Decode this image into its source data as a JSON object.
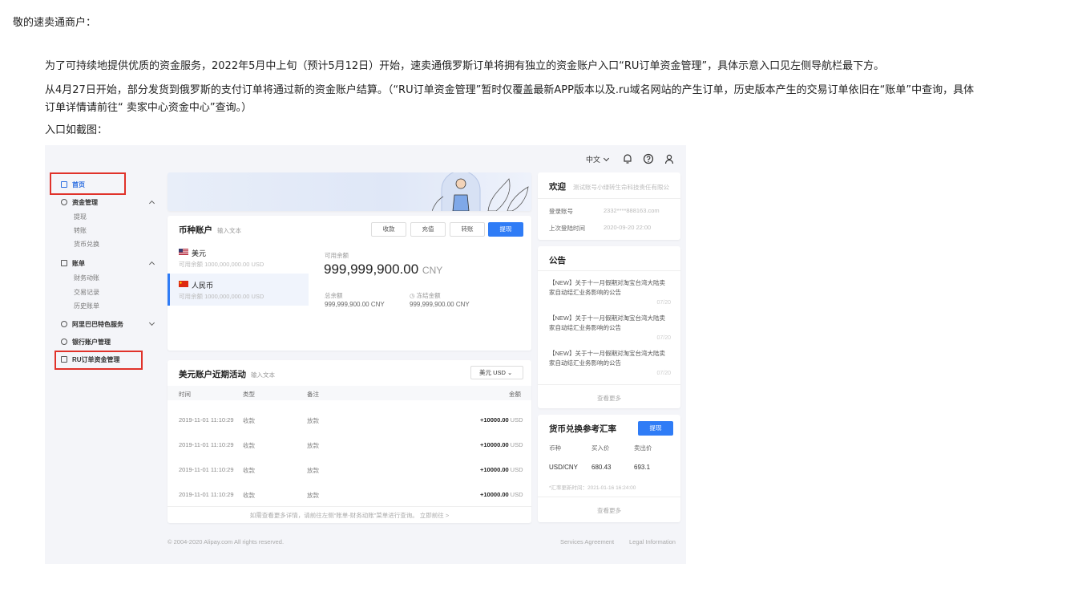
{
  "letter": {
    "greeting": "敬的速卖通商户：",
    "paragraph1": "为了可持续地提供优质的资金服务，2022年5月中上旬（预计5月12日）开始，速卖通俄罗斯订单将拥有独立的资金账户入口“RU订单资金管理”，具体示意入口见左侧导航栏最下方。",
    "paragraph2_line1": "从4月27日开始，部分发货到俄罗斯的支付订单将通过新的资金账户结算。（“RU订单资金管理”暂时仅覆盖最新APP版本以及.ru域名网站的产生订单，历史版本产生的交易订单依旧在“账单”中查询，具体",
    "paragraph2_line2": "订单详情请前往“ 卖家中心资金中心”查询。）",
    "entry_caption": "入口如截图："
  },
  "topbar": {
    "language": "中文"
  },
  "sidebar": {
    "home": "首页",
    "funds": "资金管理",
    "funds_items": [
      "提现",
      "转账",
      "货币兑换"
    ],
    "bill": "账单",
    "bill_items": [
      "财务动账",
      "交易记录",
      "历史账单"
    ],
    "alibaba": "阿里巴巴特色服务",
    "bank": "银行账户管理",
    "ru": "RU订单资金管理"
  },
  "account_card": {
    "title": "币种账户",
    "search_placeholder": "输入文本",
    "buttons": [
      "收款",
      "充值",
      "转账",
      "提现"
    ],
    "currencies": [
      {
        "name": "美元",
        "limit": "可用余额 1000,000,000.00 USD"
      },
      {
        "name": "人民币",
        "limit": "可用余额 1000,000,000.00 USD"
      }
    ],
    "available_label": "可用余额",
    "available_value": "999,999,900.00",
    "available_unit": "CNY",
    "total_label": "总余额",
    "total_value": "999,999,900.00 CNY",
    "frozen_label": "冻结金额",
    "frozen_value": "999,999,900.00 CNY"
  },
  "activity_card": {
    "title": "美元账户近期活动",
    "search_placeholder": "输入文本",
    "currency_select": "美元 USD",
    "columns": [
      "时间",
      "类型",
      "备注",
      "金额"
    ],
    "rows": [
      {
        "time": "2019-11-01 11:10:29",
        "type": "收款",
        "note": "放款",
        "amount": "+10000.00",
        "unit": "USD"
      },
      {
        "time": "2019-11-01 11:10:29",
        "type": "收款",
        "note": "放款",
        "amount": "+10000.00",
        "unit": "USD"
      },
      {
        "time": "2019-11-01 11:10:29",
        "type": "收款",
        "note": "放款",
        "amount": "+10000.00",
        "unit": "USD"
      },
      {
        "time": "2019-11-01 11:10:29",
        "type": "收款",
        "note": "放款",
        "amount": "+10000.00",
        "unit": "USD"
      }
    ],
    "footer": "如需查看更多详情，请前往左侧“账单-财务动账”菜单进行查询。 立即前往 >"
  },
  "welcome_card": {
    "title": "欢迎",
    "company": "测试账号小绿转生命科技责任有限公",
    "login_label": "登录账号",
    "login_value": "2332****888163.com",
    "last_login_label": "上次登陆时间",
    "last_login_value": "2020-09-20 22:00"
  },
  "notice_card": {
    "title": "公告",
    "items": [
      {
        "text": "【NEW】关于十一月假期对淘宝台湾大陆卖家自动结汇业务影响的公告",
        "date": "07/20"
      },
      {
        "text": "【NEW】关于十一月假期对淘宝台湾大陆卖家自动结汇业务影响的公告",
        "date": "07/20"
      },
      {
        "text": "【NEW】关于十一月假期对淘宝台湾大陆卖家自动结汇业务影响的公告",
        "date": "07/20"
      }
    ],
    "more": "查看更多"
  },
  "rates_card": {
    "title": "货币兑换参考汇率",
    "button": "提现",
    "columns": [
      "币种",
      "买入价",
      "卖出价"
    ],
    "row": {
      "pair": "USD/CNY",
      "buy": "680.43",
      "sell": "693.1"
    },
    "note": "*汇率更新时间：2021-01-16 16:24:00",
    "more": "查看更多"
  },
  "footer": {
    "copyright": "© 2004-2020 Alipay.com All rights reserved.",
    "links": [
      "Services Agreement",
      "Legal Information"
    ]
  },
  "colors": {
    "accent": "#2f7cf6",
    "highlight_box": "#e0322a"
  }
}
